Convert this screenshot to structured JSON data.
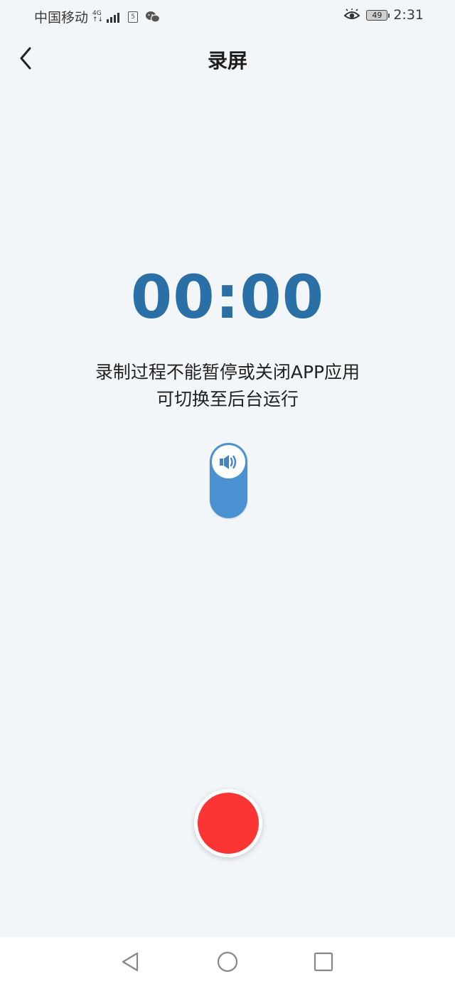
{
  "status_bar": {
    "carrier": "中国移动",
    "network": "4G",
    "battery": "49",
    "time": "2:31",
    "icons": [
      "signal-icon",
      "sim-notification-icon",
      "wechat-icon",
      "eye-comfort-icon",
      "battery-icon"
    ]
  },
  "header": {
    "back_icon": "chevron-left-icon",
    "title": "录屏"
  },
  "recorder": {
    "timer": "00:00",
    "notice_line1": "录制过程不能暂停或关闭APP应用",
    "notice_line2": "可切换至后台运行",
    "audio_toggle_icon": "speaker-icon",
    "audio_enabled": true,
    "record_icon": "record-icon"
  },
  "navbar": {
    "icons": [
      "back-triangle-icon",
      "home-circle-icon",
      "recents-square-icon"
    ]
  },
  "colors": {
    "accent": "#2a6fa6",
    "toggle": "#4a92d2",
    "record": "#fb3434",
    "background": "#f3f6f9"
  }
}
